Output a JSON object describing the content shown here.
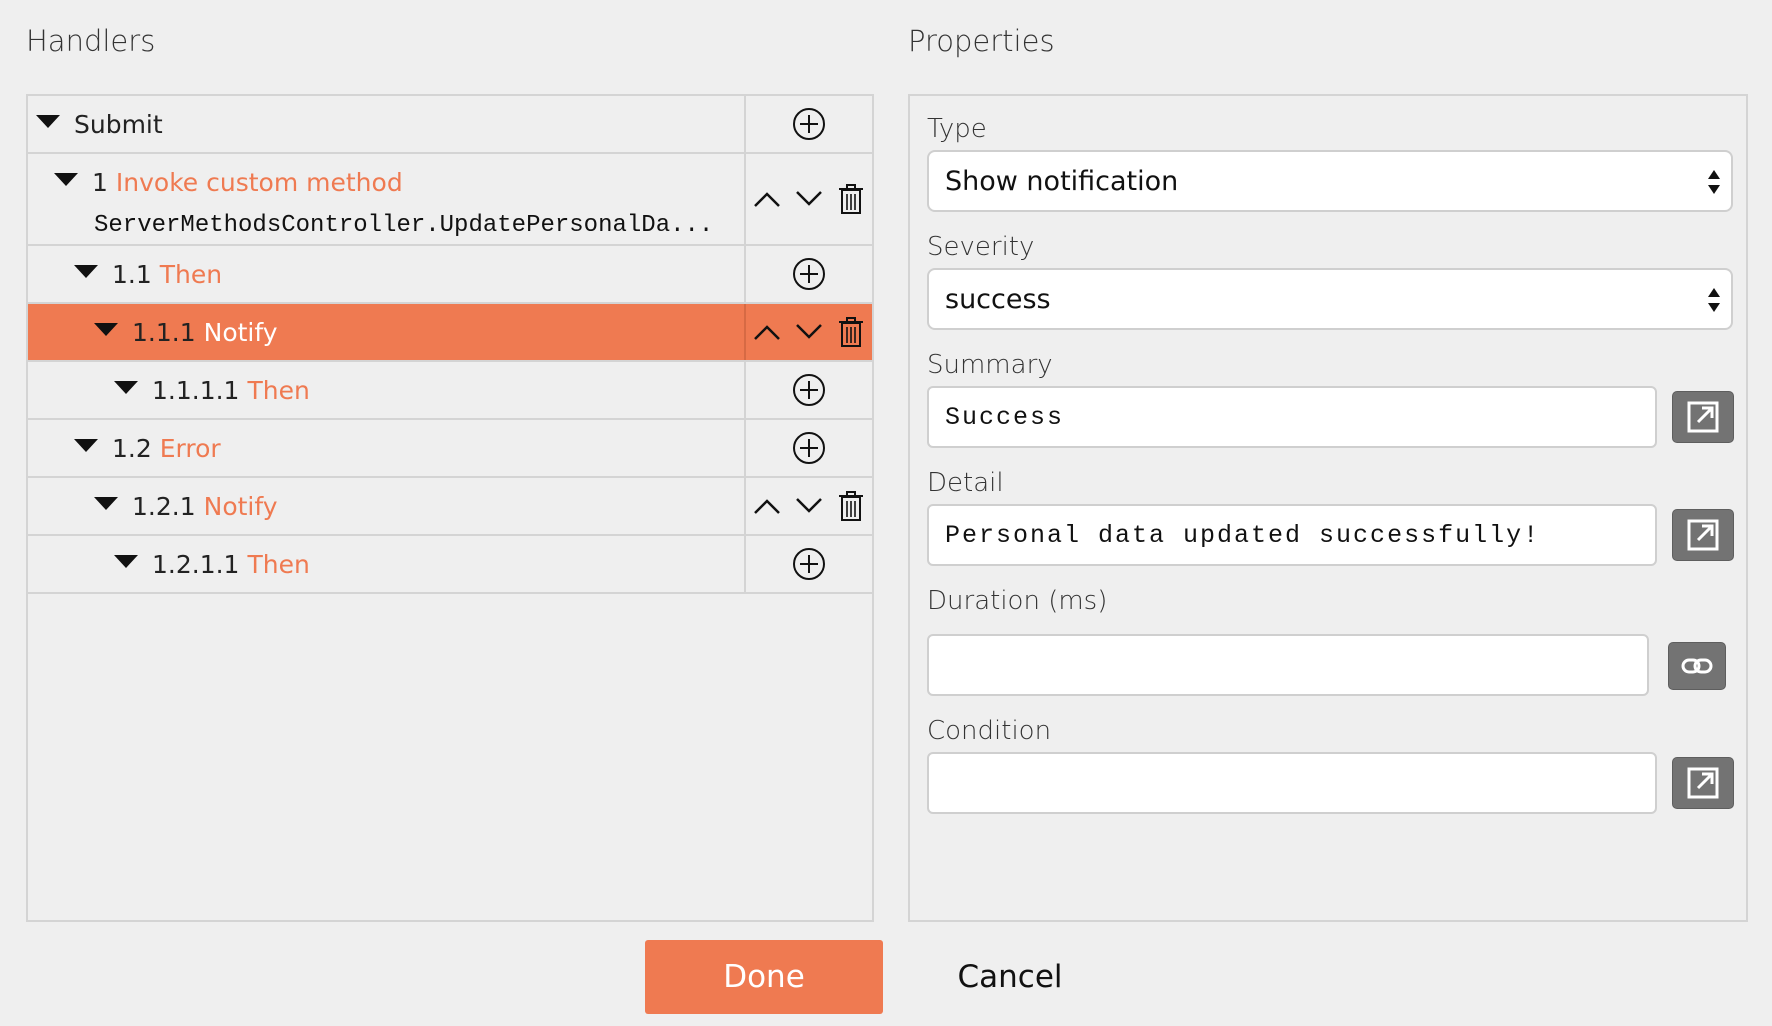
{
  "handlers": {
    "title": "Handlers",
    "rows": [
      {
        "number": "",
        "name": "Submit"
      },
      {
        "number": "1",
        "name": "Invoke custom method",
        "detail": "ServerMethodsController.UpdatePersonalDa..."
      },
      {
        "number": "1.1",
        "name": "Then"
      },
      {
        "number": "1.1.1",
        "name": "Notify"
      },
      {
        "number": "1.1.1.1",
        "name": "Then"
      },
      {
        "number": "1.2",
        "name": "Error"
      },
      {
        "number": "1.2.1",
        "name": "Notify"
      },
      {
        "number": "1.2.1.1",
        "name": "Then"
      }
    ],
    "selected_row": "1.1.1"
  },
  "properties": {
    "title": "Properties",
    "type": {
      "label": "Type",
      "value": "Show notification"
    },
    "severity": {
      "label": "Severity",
      "value": "success"
    },
    "summary": {
      "label": "Summary",
      "value": "Success"
    },
    "detail": {
      "label": "Detail",
      "value": "Personal data updated successfully!"
    },
    "duration": {
      "label": "Duration (ms)",
      "value": ""
    },
    "condition": {
      "label": "Condition",
      "value": ""
    }
  },
  "footer": {
    "done_label": "Done",
    "cancel_label": "Cancel"
  },
  "colors": {
    "accent": "#ef7a51",
    "side_button": "#737373"
  }
}
